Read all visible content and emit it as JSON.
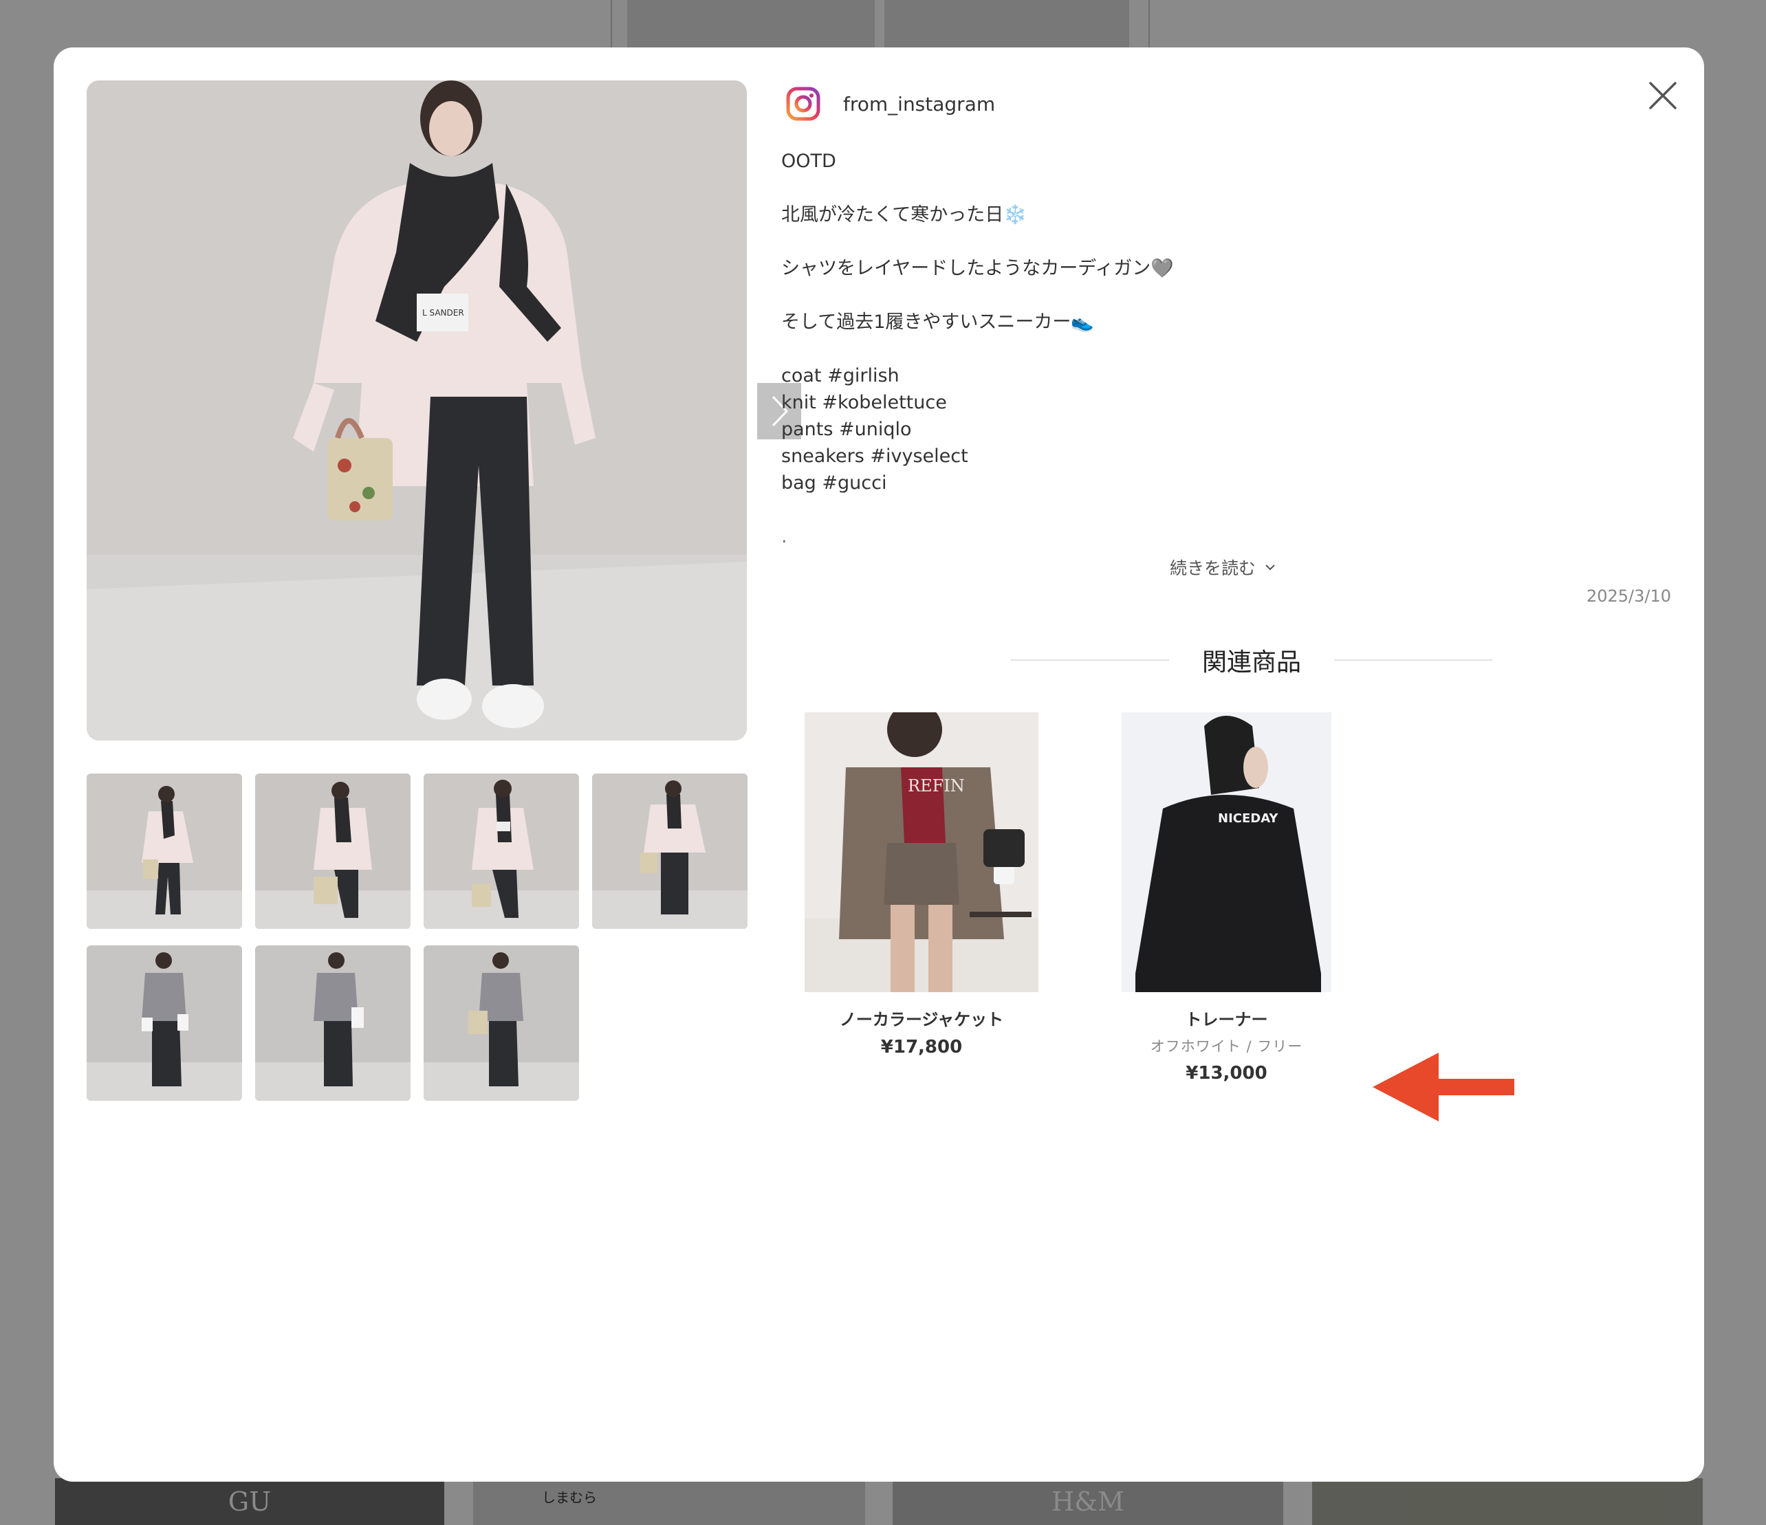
{
  "post": {
    "source_icon": "instagram-icon",
    "username": "from_instagram",
    "caption_lines": [
      "OOTD",
      "",
      "北風が冷たくて寒かった日❄️",
      "",
      "シャツをレイヤードしたようなカーディガン🩶",
      "",
      "そして過去1履きやすいスニーカー👟",
      "",
      "coat #girlish",
      "knit #kobelettuce",
      "pants #uniqlo",
      "sneakers #ivyselect",
      "bag #gucci",
      "",
      "."
    ],
    "read_more_label": "続きを読む",
    "date": "2025/3/10"
  },
  "related": {
    "title": "関連商品",
    "products": [
      {
        "name": "ノーカラージャケット",
        "variant": "",
        "price": "¥17,800"
      },
      {
        "name": "トレーナー",
        "variant": "オフホワイト / フリー",
        "price": "¥13,000"
      }
    ]
  },
  "photo_tee_text": "L SANDER",
  "product_print_1": "REFIN",
  "product_print_2": "NICEDAY",
  "background_labels": [
    "GU",
    "しまむら",
    "H&M"
  ],
  "colors": {
    "annotation_arrow": "#e8492a",
    "instagram_gradient": [
      "#f9a43a",
      "#e4405f",
      "#8a3ab9"
    ]
  }
}
